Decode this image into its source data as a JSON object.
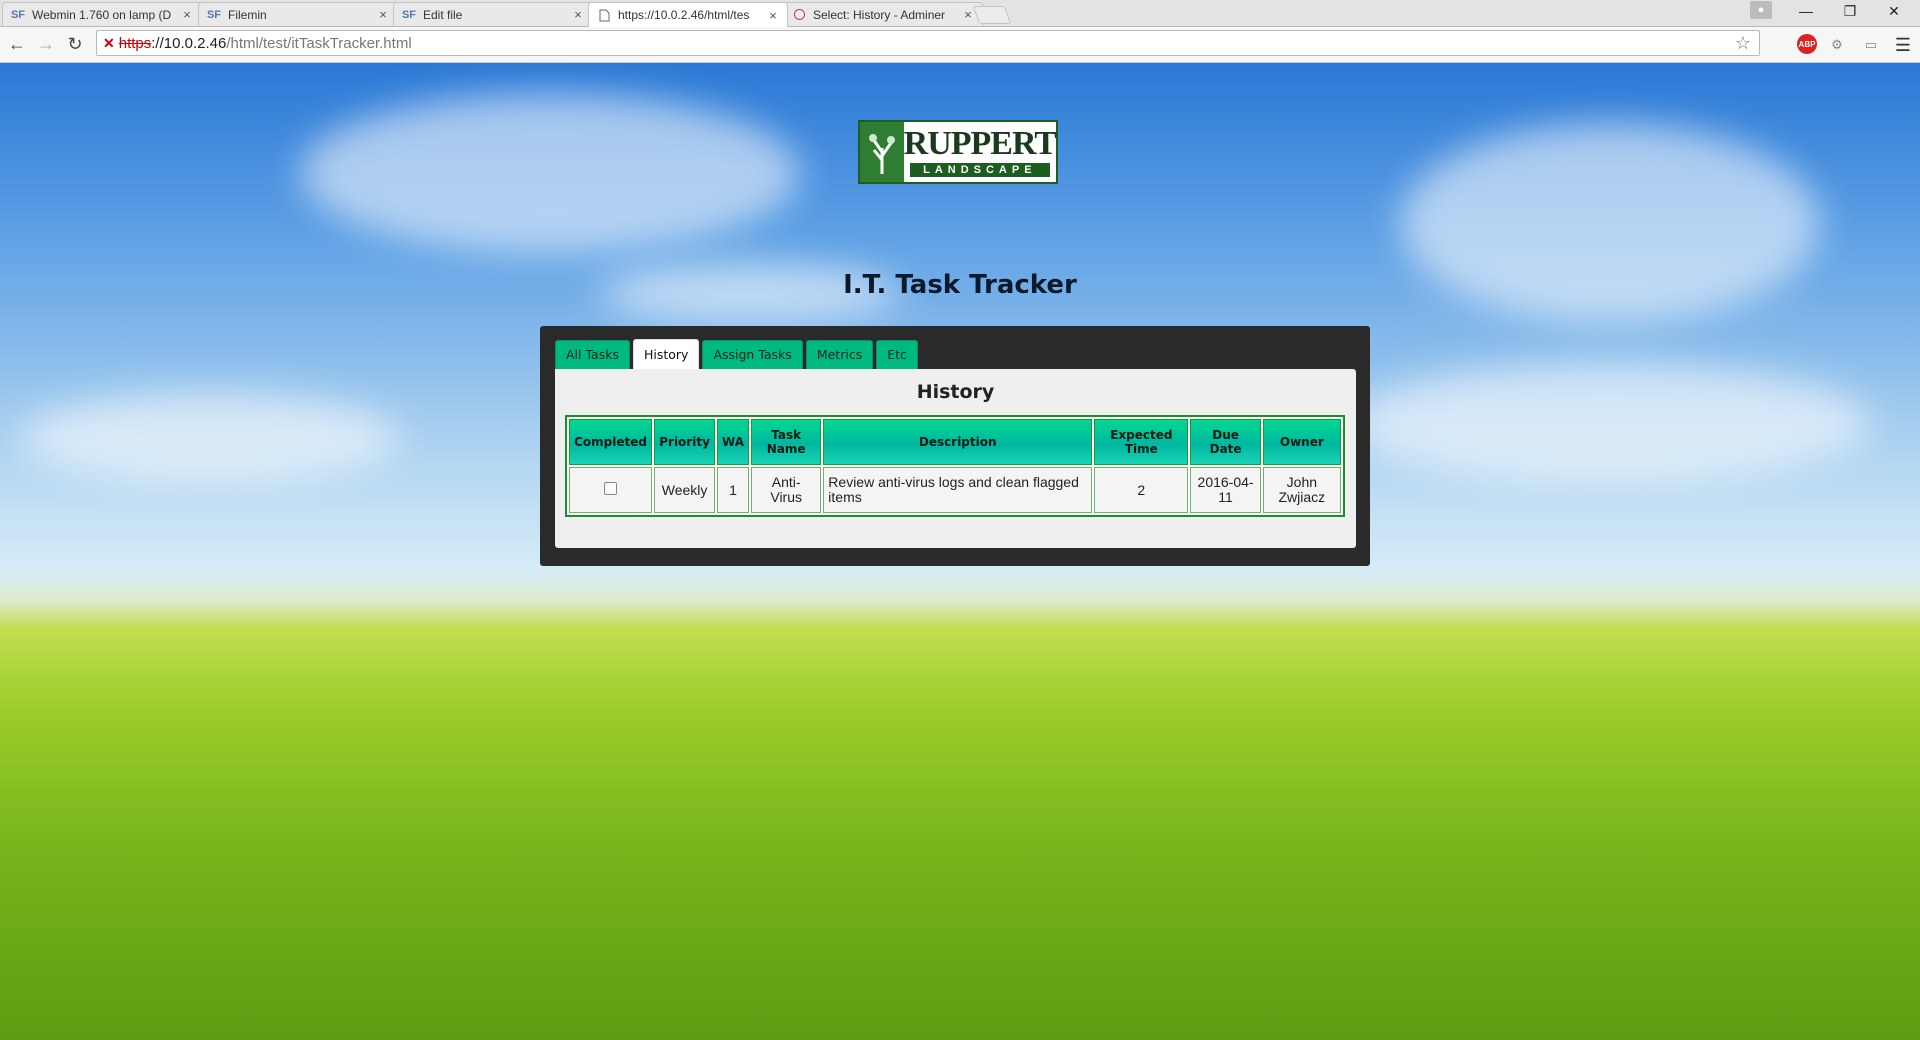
{
  "browser": {
    "tabs": [
      {
        "favicon": "SF",
        "title": "Webmin 1.760 on lamp (D",
        "active": false
      },
      {
        "favicon": "SF",
        "title": "Filemin",
        "active": false
      },
      {
        "favicon": "SF",
        "title": "Edit file",
        "active": false
      },
      {
        "favicon": "page-icon",
        "title": "https://10.0.2.46/html/tes",
        "active": true
      },
      {
        "favicon": "adminer-icon",
        "title": "Select: History - Adminer",
        "active": false
      }
    ],
    "address": {
      "security": "✕",
      "scheme": "https",
      "host": "://10.0.2.46",
      "path": "/html/test/itTaskTracker.html"
    },
    "extensions": [
      "ABP"
    ]
  },
  "page": {
    "logo": {
      "line1": "RUPPERT",
      "line2": "LANDSCAPE"
    },
    "title": "I.T. Task Tracker",
    "tabs": [
      "All Tasks",
      "History",
      "Assign Tasks",
      "Metrics",
      "Etc"
    ],
    "active_tab": "History",
    "section_title": "History",
    "table": {
      "headers": [
        "Completed",
        "Priority",
        "WA",
        "Task Name",
        "Description",
        "Expected Time",
        "Due Date",
        "Owner"
      ],
      "rows": [
        {
          "completed": false,
          "priority": "Weekly",
          "wa": "1",
          "task_name": "Anti-Virus",
          "description": "Review anti-virus logs and clean flagged items",
          "expected_time": "2",
          "due_date": "2016-04-11",
          "owner": "John Zwjiacz"
        }
      ]
    }
  },
  "colors": {
    "tab_green": "#00b980",
    "header_green": "#00d890",
    "panel_dark": "#2a2a2a"
  }
}
